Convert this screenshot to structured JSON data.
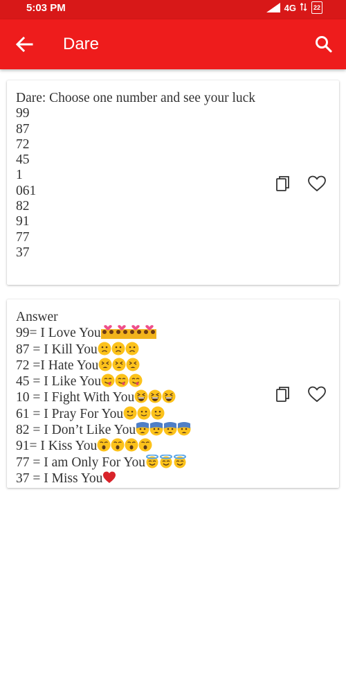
{
  "status_bar": {
    "time": "5:03 PM",
    "network": "4G",
    "battery": "22"
  },
  "app_bar": {
    "title": "Dare",
    "back_icon": "arrow-back-icon",
    "search_icon": "search-icon"
  },
  "colors": {
    "status_bar": "#d81818",
    "app_bar": "#ee1c1c"
  },
  "cards": [
    {
      "lines": [
        "Dare: Choose one number and see your luck",
        "99",
        "87",
        "72",
        "45",
        "1",
        "061",
        "82",
        "91",
        "77",
        "37"
      ],
      "copy_icon": "copy-icon",
      "favorite_icon": "heart-outline-icon"
    },
    {
      "lines": [
        {
          "text": "Answer",
          "emoji": ""
        },
        {
          "text": "99= I Love You",
          "emoji": "couple-with-heart"
        },
        {
          "text": "87 = I Kill You",
          "emoji": "frowning-face"
        },
        {
          "text": "72 =I Hate You",
          "emoji": "tired-face"
        },
        {
          "text": "45 = I Like You",
          "emoji": "yum-face"
        },
        {
          "text": "10 = I Fight With You",
          "emoji": "laughing-face"
        },
        {
          "text": "61 = I Pray For You",
          "emoji": "slight-smile-face"
        },
        {
          "text": "82 = I Don’t Like You",
          "emoji": "cold-sweat-face"
        },
        {
          "text": "91= I Kiss You",
          "emoji": "astonished-face"
        },
        {
          "text": "77 = I am Only For You",
          "emoji": "halo-face"
        },
        {
          "text": "37 = I Miss You",
          "emoji": "red-heart"
        }
      ],
      "copy_icon": "copy-icon",
      "favorite_icon": "heart-outline-icon"
    }
  ]
}
